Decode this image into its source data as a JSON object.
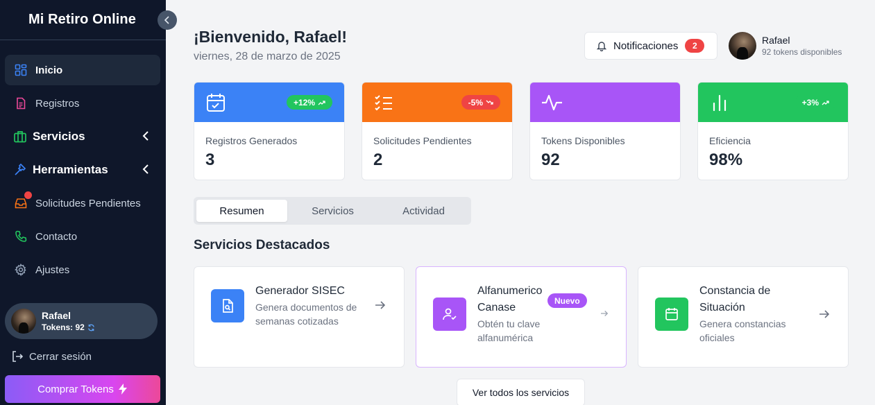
{
  "sidebar": {
    "brand": "Mi Retiro Online",
    "items": [
      {
        "label": "Inicio",
        "icon": "grid-icon"
      },
      {
        "label": "Registros",
        "icon": "document-icon"
      },
      {
        "label": "Servicios",
        "icon": "briefcase-icon"
      },
      {
        "label": "Herramientas",
        "icon": "hammer-icon"
      },
      {
        "label": "Solicitudes Pendientes",
        "icon": "inbox-icon"
      },
      {
        "label": "Contacto",
        "icon": "phone-icon"
      },
      {
        "label": "Ajustes",
        "icon": "gear-icon"
      }
    ],
    "user": {
      "name": "Rafael",
      "tokens_label": "Tokens: 92"
    },
    "logout_label": "Cerrar sesión",
    "buy_label": "Comprar Tokens"
  },
  "header": {
    "welcome": "¡Bienvenido, Rafael!",
    "date": "viernes, 28 de marzo de 2025",
    "notifications_label": "Notificaciones",
    "notifications_count": "2",
    "user_name": "Rafael",
    "user_tokens": "92 tokens disponibles"
  },
  "stats": [
    {
      "label": "Registros Generados",
      "value": "3",
      "badge": "+12%",
      "color": "#3b82f6",
      "badge_color": "#22c55e",
      "icon": "calendar-check-icon"
    },
    {
      "label": "Solicitudes Pendientes",
      "value": "2",
      "badge": "-5%",
      "color": "#f97316",
      "badge_color": "#ef4444",
      "icon": "list-check-icon"
    },
    {
      "label": "Tokens Disponibles",
      "value": "92",
      "badge": "",
      "color": "#a855f7",
      "icon": "activity-icon"
    },
    {
      "label": "Eficiencia",
      "value": "98%",
      "badge": "+3%",
      "color": "#22c55e",
      "badge_color": "#22c55e",
      "icon": "bar-chart-icon"
    }
  ],
  "tabs": [
    "Resumen",
    "Servicios",
    "Actividad"
  ],
  "section_title": "Servicios Destacados",
  "services": [
    {
      "title": "Generador SISEC",
      "desc": "Genera documentos de semanas cotizadas",
      "color": "#3b82f6",
      "icon": "file-search-icon"
    },
    {
      "title": "Alfanumerico Canase",
      "desc": "Obtén tu clave alfanumérica",
      "badge": "Nuevo",
      "color": "#a855f7",
      "icon": "user-check-icon"
    },
    {
      "title": "Constancia de Situación",
      "desc": "Genera constancias oficiales",
      "color": "#22c55e",
      "icon": "calendar-icon"
    }
  ],
  "view_all_label": "Ver todos los servicios"
}
